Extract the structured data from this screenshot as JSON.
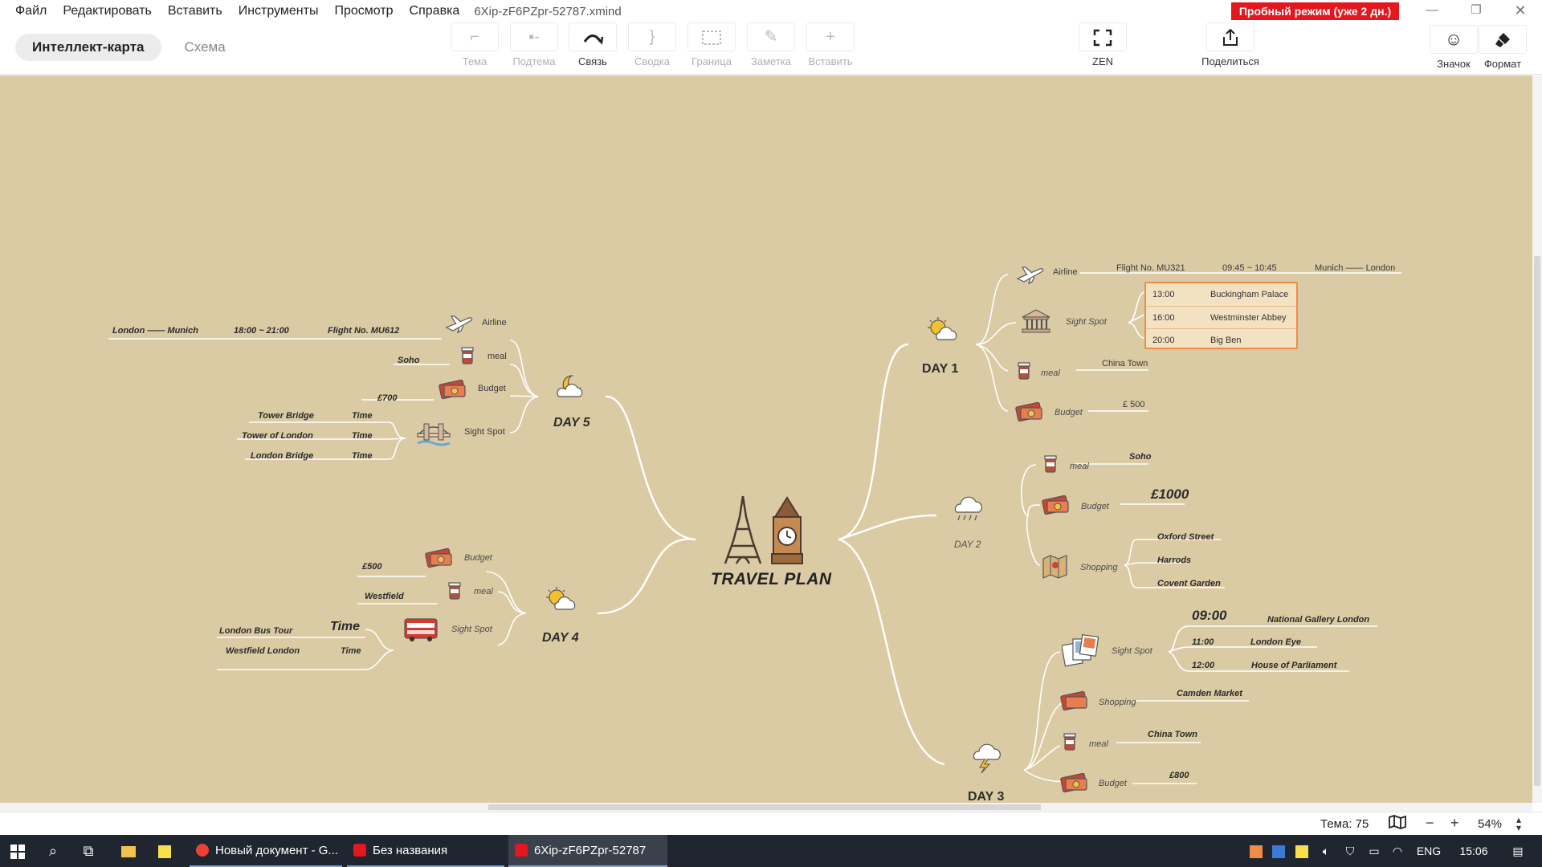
{
  "menu": {
    "items": [
      "Файл",
      "Редактировать",
      "Вставить",
      "Инструменты",
      "Просмотр",
      "Справка"
    ],
    "filename": "6Xip-zF6PZpr-52787.xmind",
    "trial": "Пробный режим (уже 2 дн.)"
  },
  "view_tabs": {
    "mindmap": "Интеллект-карта",
    "outline": "Схема"
  },
  "toolbar": {
    "topic": "Тема",
    "subtopic": "Подтема",
    "relationship": "Связь",
    "summary": "Сводка",
    "boundary": "Граница",
    "note": "Заметка",
    "insert": "Вставить",
    "zen": "ZEN",
    "share": "Поделиться",
    "icon": "Значок",
    "format": "Формат"
  },
  "map": {
    "central": "TRAVEL PLAN",
    "day1": {
      "title": "DAY 1",
      "airline": "Airline",
      "flight": "Flight No. MU321",
      "flight_time": "09:45 ~ 10:45",
      "route": "Munich —— London",
      "sight_label": "Sight Spot",
      "sights": [
        {
          "time": "13:00",
          "place": "Buckingham Palace"
        },
        {
          "time": "16:00",
          "place": "Westminster Abbey"
        },
        {
          "time": "20:00",
          "place": "Big Ben"
        }
      ],
      "meal_label": "meal",
      "meal": "China Town",
      "budget_label": "Budget",
      "budget": "£ 500"
    },
    "day2": {
      "title": "DAY 2",
      "meal_label": "meal",
      "meal": "Soho",
      "budget_label": "Budget",
      "budget": "£1000",
      "shopping_label": "Shopping",
      "shopping": [
        "Oxford Street",
        "Harrods",
        "Covent Garden"
      ]
    },
    "day3": {
      "title": "DAY 3",
      "sight_label": "Sight Spot",
      "sights": [
        {
          "time": "09:00",
          "place": "National Gallery London"
        },
        {
          "time": "11:00",
          "place": "London Eye"
        },
        {
          "time": "12:00",
          "place": "House of Parliament"
        }
      ],
      "shopping_label": "Shopping",
      "shopping": "Camden Market",
      "meal_label": "meal",
      "meal": "China Town",
      "budget_label": "Budget",
      "budget": "£800"
    },
    "day4": {
      "title": "DAY 4",
      "budget_label": "Budget",
      "budget": "£500",
      "meal_label": "meal",
      "meal": "Westfield",
      "sight_label": "Sight Spot",
      "sights": [
        {
          "place": "London Bus Tour",
          "time": "Time"
        },
        {
          "place": "Westfield London",
          "time": "Time"
        }
      ]
    },
    "day5": {
      "title": "DAY 5",
      "airline": "Airline",
      "route": "London —— Munich",
      "flight_time": "18:00 ~ 21:00",
      "flight": "Flight No. MU612",
      "meal_label": "meal",
      "meal": "Soho",
      "budget_label": "Budget",
      "budget": "£700",
      "sight_label": "Sight Spot",
      "sights": [
        {
          "place": "Tower Bridge",
          "time": "Time"
        },
        {
          "place": "Tower of London",
          "time": "Time"
        },
        {
          "place": "London Bridge",
          "time": "Time"
        }
      ]
    }
  },
  "status": {
    "theme": "Тема: 75",
    "zoom": "54%"
  },
  "taskbar": {
    "apps": [
      "Новый документ - G...",
      "Без названия",
      "6Xip-zF6PZpr-52787"
    ],
    "lang": "ENG",
    "clock": "15:06"
  }
}
